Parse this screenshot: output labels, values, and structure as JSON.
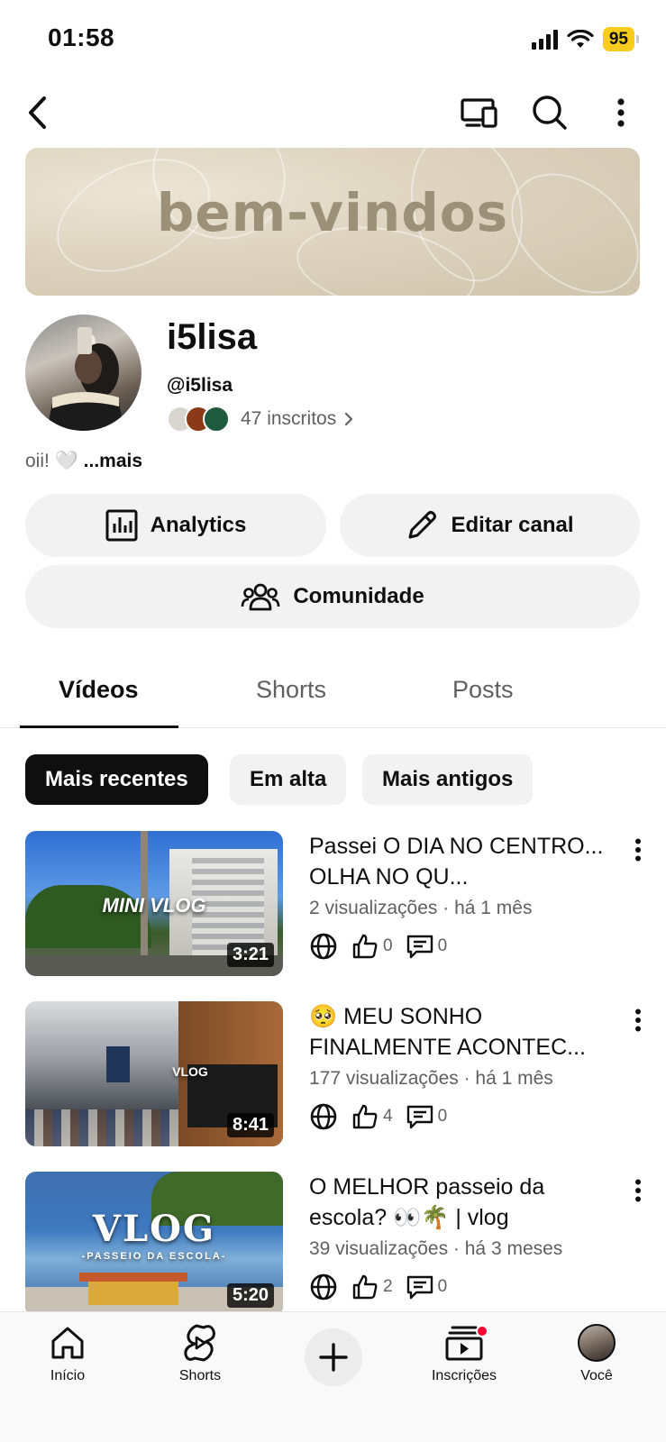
{
  "status_bar": {
    "time": "01:58",
    "battery": "95"
  },
  "banner": {
    "text": "bem-vindos"
  },
  "channel": {
    "name": "i5lisa",
    "handle": "@i5lisa",
    "subscribers": "47 inscritos",
    "description": "oii! 🤍",
    "more": "...mais"
  },
  "actions": {
    "analytics": "Analytics",
    "edit": "Editar canal",
    "community": "Comunidade"
  },
  "tabs": [
    "Vídeos",
    "Shorts",
    "Posts"
  ],
  "chips": [
    "Mais recentes",
    "Em alta",
    "Mais antigos"
  ],
  "videos": [
    {
      "title": "Passei O DIA NO CENTRO... OLHA NO QU...",
      "meta": "2 visualizações · há 1 mês",
      "likes": "0",
      "comments": "0",
      "duration": "3:21",
      "thumb_label": "MINI VLOG"
    },
    {
      "title": "🥺 MEU SONHO FINALMENTE ACONTEC...",
      "meta": "177 visualizações · há 1 mês",
      "likes": "4",
      "comments": "0",
      "duration": "8:41",
      "thumb_label": "VLOG"
    },
    {
      "title": "O MELHOR passeio da escola? 👀🌴 | vlog",
      "meta": "39 visualizações · há 3 meses",
      "likes": "2",
      "comments": "0",
      "duration": "5:20",
      "thumb_label": "VLOG",
      "thumb_sublabel": "-PASSEIO DA ESCOLA-"
    }
  ],
  "bottom_nav": {
    "home": "Início",
    "shorts": "Shorts",
    "subscriptions": "Inscrições",
    "you": "Você"
  },
  "icons": {
    "back": "chevron-left-icon",
    "cast": "cast-icon",
    "search": "search-icon",
    "more": "more-vertical-icon",
    "visibility": "globe-icon",
    "like": "thumbs-up-icon",
    "comment": "comment-icon"
  }
}
